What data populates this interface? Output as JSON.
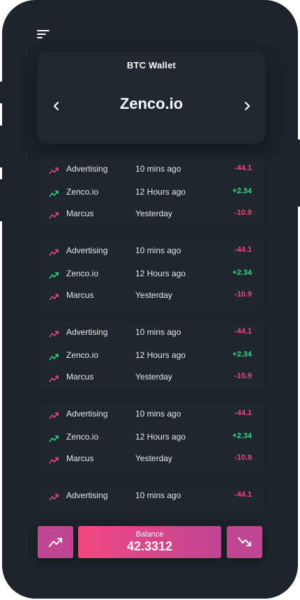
{
  "header": {
    "menu_icon": "hamburger-menu-icon"
  },
  "wallet": {
    "label": "BTC Wallet",
    "name": "Zenco.io",
    "prev_icon": "chevron-left-icon",
    "next_icon": "chevron-right-icon"
  },
  "transaction_groups": [
    {
      "rows": [
        {
          "name": "Advertising",
          "time": "10 mins ago",
          "amount": "-44.1",
          "direction": "down"
        },
        {
          "name": "Zenco.io",
          "time": "12 Hours ago",
          "amount": "+2.34",
          "direction": "up"
        },
        {
          "name": "Marcus",
          "time": "Yesterday",
          "amount": "-10.9",
          "direction": "down"
        }
      ]
    },
    {
      "rows": [
        {
          "name": "Advertising",
          "time": "10 mins ago",
          "amount": "-44.1",
          "direction": "down"
        },
        {
          "name": "Zenco.io",
          "time": "12 Hours ago",
          "amount": "+2.34",
          "direction": "up"
        },
        {
          "name": "Marcus",
          "time": "Yesterday",
          "amount": "-10.9",
          "direction": "down"
        }
      ]
    },
    {
      "rows": [
        {
          "name": "Advertising",
          "time": "10 mins ago",
          "amount": "-44.1",
          "direction": "down"
        },
        {
          "name": "Zenco.io",
          "time": "12 Hours ago",
          "amount": "+2.34",
          "direction": "up"
        },
        {
          "name": "Marcus",
          "time": "Yesterday",
          "amount": "-10.9",
          "direction": "down"
        }
      ]
    },
    {
      "rows": [
        {
          "name": "Advertising",
          "time": "10 mins ago",
          "amount": "-44.1",
          "direction": "down"
        },
        {
          "name": "Zenco.io",
          "time": "12 Hours ago",
          "amount": "+2.34",
          "direction": "up"
        },
        {
          "name": "Marcus",
          "time": "Yesterday",
          "amount": "-10.9",
          "direction": "down"
        }
      ]
    },
    {
      "rows": [
        {
          "name": "Advertising",
          "time": "10 mins ago",
          "amount": "-44.1",
          "direction": "down"
        }
      ]
    }
  ],
  "footer": {
    "balance_label": "Balance",
    "balance_value": "42.3312",
    "left_icon": "trending-up-icon",
    "right_icon": "trending-down-icon"
  },
  "colors": {
    "background": "#1c2429",
    "card": "#1f282e",
    "positive": "#2bd68a",
    "negative": "#f0457f",
    "accent_start": "#f24882",
    "accent_end": "#c04592"
  }
}
